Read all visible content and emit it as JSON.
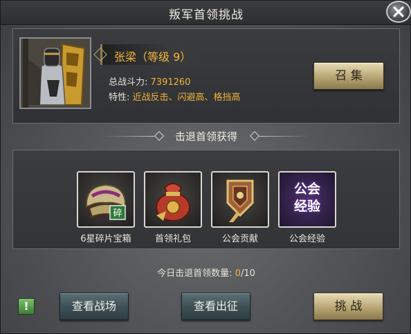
{
  "window": {
    "title": "叛军首领挑战"
  },
  "boss": {
    "name": "张梁（等级 9）",
    "power_label": "总战斗力:",
    "power_value": "7391260",
    "traits_label": "特性:",
    "traits_value": "近战反击、闪避高、格挡高",
    "summon_label": "召 集"
  },
  "rewards": {
    "header": "击退首领获得",
    "items": [
      {
        "label": "6星碎片宝箱",
        "icon": "shard-chest-icon"
      },
      {
        "label": "首领礼包",
        "icon": "gift-bag-icon"
      },
      {
        "label": "公会贡献",
        "icon": "guild-contribution-icon"
      },
      {
        "label": "公会经验",
        "icon": "guild-exp-icon",
        "icon_text_1": "公会",
        "icon_text_2": "经验"
      }
    ]
  },
  "daily": {
    "label": "今日击退首领数量: ",
    "current": "0",
    "max": "/10"
  },
  "actions": {
    "hint_label": "!",
    "view_battlefield": "查看战场",
    "view_expedition": "查看出征",
    "challenge": "挑 战"
  },
  "colors": {
    "gold_text": "#f2b53a",
    "gold_button": "#b8a574",
    "teal_button": "#3d4f55"
  }
}
